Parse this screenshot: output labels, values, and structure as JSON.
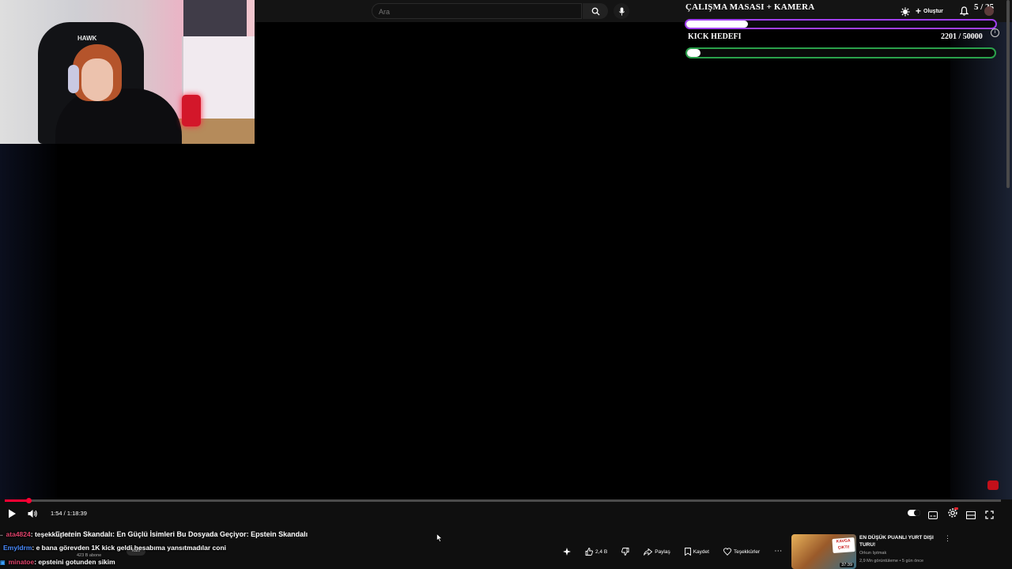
{
  "search": {
    "placeholder": "Ara"
  },
  "overlay": {
    "title": "ÇALIŞMA MASASI + KAMERA",
    "bar1_progress": 0.2,
    "goal_label": "KICK HEDEFI",
    "goal_count": "2201 / 50000",
    "goal_current": 2201,
    "goal_target": 50000,
    "bar1_color": "#a13ff0",
    "bar2_color": "#2aa14b"
  },
  "webcam": {
    "chair_logo": "HAWK"
  },
  "header": {
    "create_label": "Oluştur",
    "notif_count": "5 / 25"
  },
  "player": {
    "time": "1:54 / 1:18:39",
    "progress": 0.024,
    "accent": "#ff0033"
  },
  "video": {
    "title": "Epstein Skandalı: En Güçlü İsimleri Bu Dosyada Geçiyor: Epstein Skandalı",
    "subs": "423 B abone",
    "join": "Katıl"
  },
  "actions": {
    "likes": "2,4 B",
    "share": "Paylaş",
    "save": "Kaydet",
    "thanks": "Teşekkürler"
  },
  "chat": [
    {
      "user": "ata4824",
      "color": "#e0436b",
      "text": ": teşekkürlerr"
    },
    {
      "user": "Emyldrm",
      "color": "#4a8cff",
      "text": ": e bana görevden 1K kick geldi hesabıma yansıtmadılar coni"
    },
    {
      "user": "minatoe",
      "color": "#e0436b",
      "text": ": epsteini gotunden sikim"
    }
  ],
  "recommendation": {
    "title": "EN DÜŞÜK PUANLI YURT DIŞI TURU!",
    "channel": "Orkun Işıtmak",
    "meta": "2,9 Mn görüntüleme • 5 gün önce",
    "duration": "37:39",
    "badge": "KAVGA ÇIKTI!"
  }
}
